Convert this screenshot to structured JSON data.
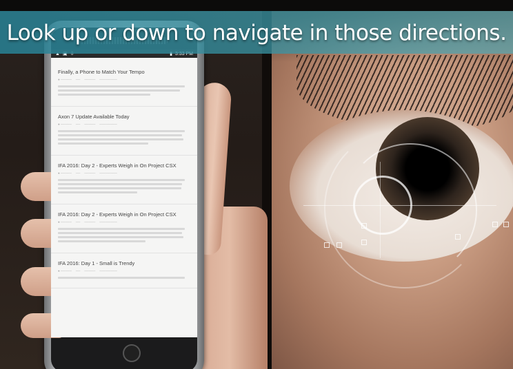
{
  "headline": "Look up or down to navigate in those directions.",
  "status_bar": {
    "time": "3:33 PM",
    "icons": [
      "warning-icon",
      "image-icon",
      "download-icon",
      "battery-icon"
    ]
  },
  "screen": {
    "top_link": "",
    "read_more": "",
    "posts": [
      {
        "title": "Finally, a Phone to Match Your Tempo"
      },
      {
        "title": "Axon 7 Update Available Today"
      },
      {
        "title": "IFA 2016: Day 2 - Experts Weigh in On Project CSX"
      },
      {
        "title": "IFA 2016: Day 2 - Experts Weigh in On Project CSX"
      },
      {
        "title": "IFA 2016: Day 1 - Small is Trendy"
      }
    ]
  },
  "colors": {
    "banner": "#2f8c9d",
    "headline_text": "#ffffff",
    "screen_bg": "#f5f5f4"
  }
}
